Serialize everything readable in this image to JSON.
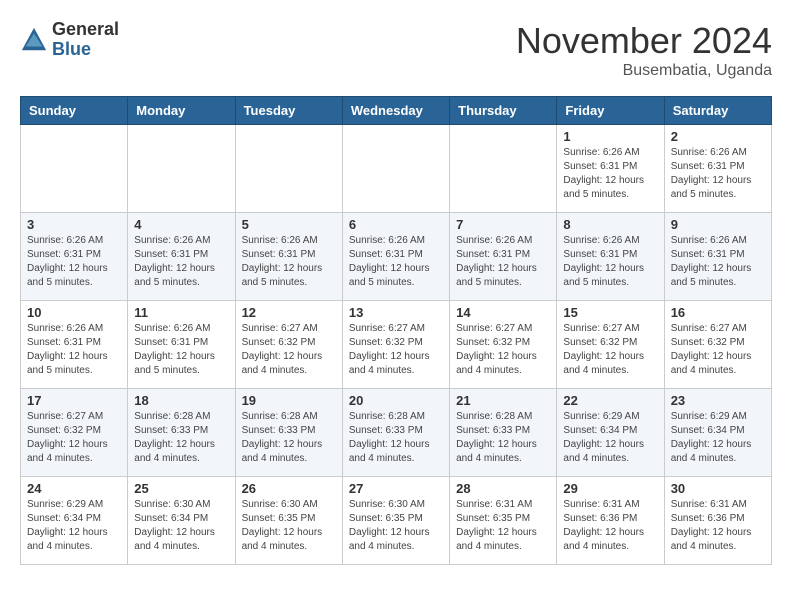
{
  "logo": {
    "general": "General",
    "blue": "Blue"
  },
  "title": "November 2024",
  "subtitle": "Busembatia, Uganda",
  "days_of_week": [
    "Sunday",
    "Monday",
    "Tuesday",
    "Wednesday",
    "Thursday",
    "Friday",
    "Saturday"
  ],
  "weeks": [
    [
      {
        "day": "",
        "info": ""
      },
      {
        "day": "",
        "info": ""
      },
      {
        "day": "",
        "info": ""
      },
      {
        "day": "",
        "info": ""
      },
      {
        "day": "",
        "info": ""
      },
      {
        "day": "1",
        "info": "Sunrise: 6:26 AM\nSunset: 6:31 PM\nDaylight: 12 hours and 5 minutes."
      },
      {
        "day": "2",
        "info": "Sunrise: 6:26 AM\nSunset: 6:31 PM\nDaylight: 12 hours and 5 minutes."
      }
    ],
    [
      {
        "day": "3",
        "info": "Sunrise: 6:26 AM\nSunset: 6:31 PM\nDaylight: 12 hours and 5 minutes."
      },
      {
        "day": "4",
        "info": "Sunrise: 6:26 AM\nSunset: 6:31 PM\nDaylight: 12 hours and 5 minutes."
      },
      {
        "day": "5",
        "info": "Sunrise: 6:26 AM\nSunset: 6:31 PM\nDaylight: 12 hours and 5 minutes."
      },
      {
        "day": "6",
        "info": "Sunrise: 6:26 AM\nSunset: 6:31 PM\nDaylight: 12 hours and 5 minutes."
      },
      {
        "day": "7",
        "info": "Sunrise: 6:26 AM\nSunset: 6:31 PM\nDaylight: 12 hours and 5 minutes."
      },
      {
        "day": "8",
        "info": "Sunrise: 6:26 AM\nSunset: 6:31 PM\nDaylight: 12 hours and 5 minutes."
      },
      {
        "day": "9",
        "info": "Sunrise: 6:26 AM\nSunset: 6:31 PM\nDaylight: 12 hours and 5 minutes."
      }
    ],
    [
      {
        "day": "10",
        "info": "Sunrise: 6:26 AM\nSunset: 6:31 PM\nDaylight: 12 hours and 5 minutes."
      },
      {
        "day": "11",
        "info": "Sunrise: 6:26 AM\nSunset: 6:31 PM\nDaylight: 12 hours and 5 minutes."
      },
      {
        "day": "12",
        "info": "Sunrise: 6:27 AM\nSunset: 6:32 PM\nDaylight: 12 hours and 4 minutes."
      },
      {
        "day": "13",
        "info": "Sunrise: 6:27 AM\nSunset: 6:32 PM\nDaylight: 12 hours and 4 minutes."
      },
      {
        "day": "14",
        "info": "Sunrise: 6:27 AM\nSunset: 6:32 PM\nDaylight: 12 hours and 4 minutes."
      },
      {
        "day": "15",
        "info": "Sunrise: 6:27 AM\nSunset: 6:32 PM\nDaylight: 12 hours and 4 minutes."
      },
      {
        "day": "16",
        "info": "Sunrise: 6:27 AM\nSunset: 6:32 PM\nDaylight: 12 hours and 4 minutes."
      }
    ],
    [
      {
        "day": "17",
        "info": "Sunrise: 6:27 AM\nSunset: 6:32 PM\nDaylight: 12 hours and 4 minutes."
      },
      {
        "day": "18",
        "info": "Sunrise: 6:28 AM\nSunset: 6:33 PM\nDaylight: 12 hours and 4 minutes."
      },
      {
        "day": "19",
        "info": "Sunrise: 6:28 AM\nSunset: 6:33 PM\nDaylight: 12 hours and 4 minutes."
      },
      {
        "day": "20",
        "info": "Sunrise: 6:28 AM\nSunset: 6:33 PM\nDaylight: 12 hours and 4 minutes."
      },
      {
        "day": "21",
        "info": "Sunrise: 6:28 AM\nSunset: 6:33 PM\nDaylight: 12 hours and 4 minutes."
      },
      {
        "day": "22",
        "info": "Sunrise: 6:29 AM\nSunset: 6:34 PM\nDaylight: 12 hours and 4 minutes."
      },
      {
        "day": "23",
        "info": "Sunrise: 6:29 AM\nSunset: 6:34 PM\nDaylight: 12 hours and 4 minutes."
      }
    ],
    [
      {
        "day": "24",
        "info": "Sunrise: 6:29 AM\nSunset: 6:34 PM\nDaylight: 12 hours and 4 minutes."
      },
      {
        "day": "25",
        "info": "Sunrise: 6:30 AM\nSunset: 6:34 PM\nDaylight: 12 hours and 4 minutes."
      },
      {
        "day": "26",
        "info": "Sunrise: 6:30 AM\nSunset: 6:35 PM\nDaylight: 12 hours and 4 minutes."
      },
      {
        "day": "27",
        "info": "Sunrise: 6:30 AM\nSunset: 6:35 PM\nDaylight: 12 hours and 4 minutes."
      },
      {
        "day": "28",
        "info": "Sunrise: 6:31 AM\nSunset: 6:35 PM\nDaylight: 12 hours and 4 minutes."
      },
      {
        "day": "29",
        "info": "Sunrise: 6:31 AM\nSunset: 6:36 PM\nDaylight: 12 hours and 4 minutes."
      },
      {
        "day": "30",
        "info": "Sunrise: 6:31 AM\nSunset: 6:36 PM\nDaylight: 12 hours and 4 minutes."
      }
    ]
  ]
}
